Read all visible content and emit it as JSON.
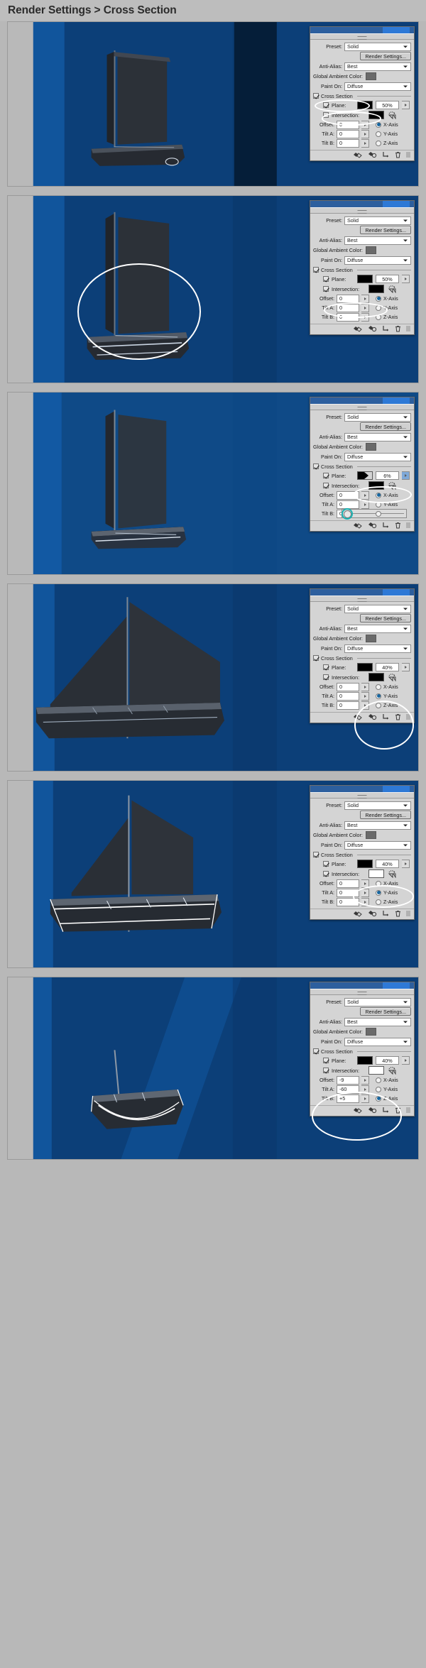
{
  "header": {
    "title": "Render Settings > Cross Section"
  },
  "panel_labels": {
    "preset": "Preset:",
    "render_settings_button": "Render Settings...",
    "anti_alias": "Anti-Alias:",
    "global_ambient_color": "Global Ambient Color:",
    "paint_on": "Paint On:",
    "cross_section": "Cross Section",
    "plane": "Plane:",
    "intersection": "Intersection:",
    "offset": "Offset:",
    "tilt_a": "Tilt A:",
    "tilt_b": "Tilt B:",
    "x_axis": "X-Axis",
    "y_axis": "Y-Axis",
    "z_axis": "Z-Axis"
  },
  "panel_values": {
    "preset": "Solid",
    "anti_alias": "Best",
    "paint_on": "Diffuse"
  },
  "colors": {
    "canvas_blue": "#0f4a87",
    "canvas_blue_dark": "#0c3f78",
    "canvas_blue_light": "#11559c",
    "panel_face": "#d4d4d4",
    "header_bg": "#bdbdbd",
    "page_bg": "#b8b8b8",
    "highlight_ring": "#ffffff",
    "accent_blue": "#2e79d6",
    "teal_ring": "#19b3b3",
    "ambient_swatch": "#6a6a6a"
  },
  "icons": {
    "caret": "chevron-down-icon",
    "spinner": "spinner-arrow-icon",
    "flip": "flip-intersection-icon",
    "footer_1": "toggle-ground-plane-icon",
    "footer_2": "toggle-light-icon",
    "footer_3": "new-light-icon",
    "footer_4": "delete-light-icon",
    "footer_5": "panel-grip-icon"
  },
  "frames": [
    {
      "id": "frame-1",
      "caption": "",
      "plane_checked": true,
      "plane_pct": "50%",
      "plane_swatch": "black",
      "intersection_checked": false,
      "intersection_swatch": "black",
      "offset": "0",
      "tilt_a": "0",
      "tilt_b": "0",
      "axis": "x",
      "highlights": [
        "cross-section-checkbox",
        "plane-row"
      ],
      "has_slider_popup": false,
      "boat": "upright-full"
    },
    {
      "id": "frame-2",
      "caption": "",
      "plane_checked": true,
      "plane_pct": "50%",
      "plane_swatch": "black",
      "intersection_checked": true,
      "intersection_swatch": "black",
      "offset": "0",
      "tilt_a": "0",
      "tilt_b": "0",
      "axis": "x",
      "highlights": [
        "intersection-row",
        "canvas-hull"
      ],
      "has_slider_popup": false,
      "boat": "upright-hull-outline"
    },
    {
      "id": "frame-3",
      "caption": "",
      "plane_checked": true,
      "plane_pct": "6%",
      "plane_swatch": "gradient",
      "intersection_checked": true,
      "intersection_swatch": "black",
      "offset": "0",
      "tilt_a": "0",
      "tilt_b": "0",
      "axis": "x",
      "highlights": [
        "plane-opacity-field"
      ],
      "has_slider_popup": true,
      "boat": "upright-transparent"
    },
    {
      "id": "frame-4",
      "caption": "",
      "plane_checked": true,
      "plane_pct": "40%",
      "plane_swatch": "black",
      "intersection_checked": true,
      "intersection_swatch": "black",
      "offset": "0",
      "tilt_a": "0",
      "tilt_b": "0",
      "axis": "y",
      "highlights": [
        "axis-radio-group"
      ],
      "has_slider_popup": false,
      "boat": "wide-sail"
    },
    {
      "id": "frame-5",
      "caption": "",
      "plane_checked": true,
      "plane_pct": "40%",
      "plane_swatch": "black",
      "intersection_checked": true,
      "intersection_swatch": "white",
      "offset": "0",
      "tilt_a": "0",
      "tilt_b": "0",
      "axis": "y",
      "highlights": [
        "intersection-swatch"
      ],
      "has_slider_popup": false,
      "boat": "white-outline"
    },
    {
      "id": "frame-6",
      "caption": "",
      "plane_checked": true,
      "plane_pct": "40%",
      "plane_swatch": "black",
      "intersection_checked": true,
      "intersection_swatch": "white",
      "offset": "-9",
      "tilt_a": "-60",
      "tilt_b": "+5",
      "axis": "z",
      "highlights": [
        "numeric-fields-group"
      ],
      "has_slider_popup": false,
      "boat": "tilted-hull"
    }
  ]
}
